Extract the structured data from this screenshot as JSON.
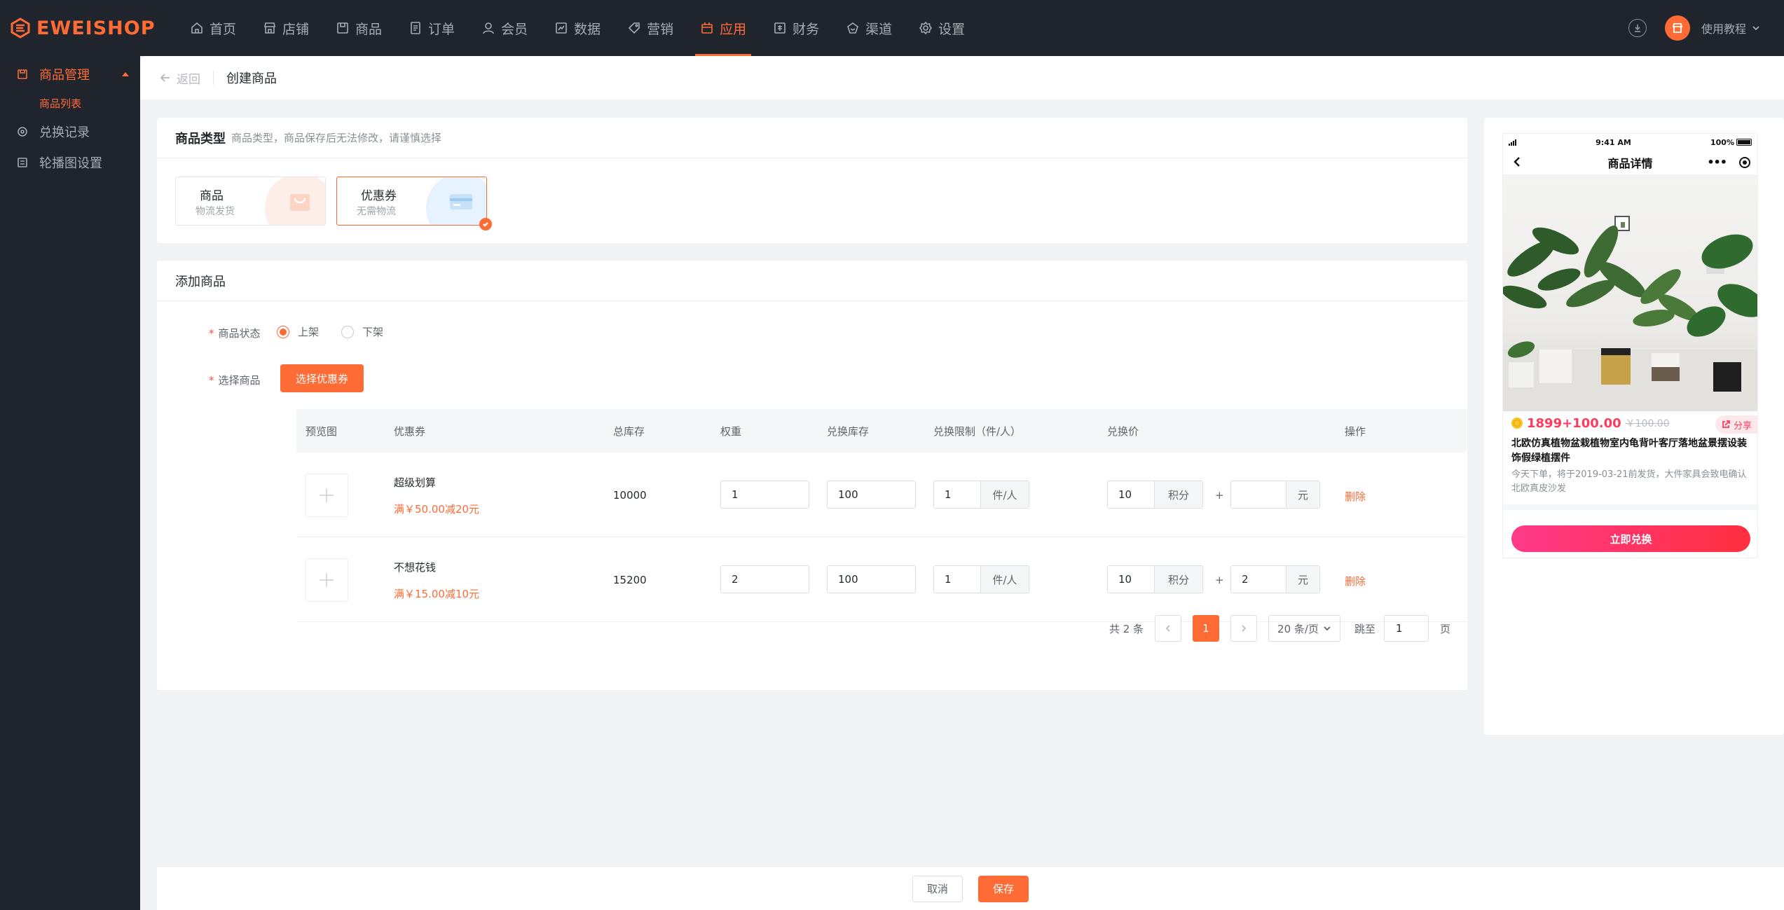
{
  "brand": {
    "name": "EWEISHOP",
    "accent": "#ff6b35"
  },
  "topnav": [
    {
      "label": "首页",
      "icon": "home-icon"
    },
    {
      "label": "店铺",
      "icon": "store-icon"
    },
    {
      "label": "商品",
      "icon": "goods-icon"
    },
    {
      "label": "订单",
      "icon": "order-icon"
    },
    {
      "label": "会员",
      "icon": "member-icon"
    },
    {
      "label": "数据",
      "icon": "chart-icon"
    },
    {
      "label": "营销",
      "icon": "tag-icon"
    },
    {
      "label": "应用",
      "icon": "app-icon",
      "active": true
    },
    {
      "label": "财务",
      "icon": "finance-icon"
    },
    {
      "label": "渠道",
      "icon": "channel-icon"
    },
    {
      "label": "设置",
      "icon": "gear-icon"
    }
  ],
  "topright": {
    "tutorial": "使用教程"
  },
  "sidebar": {
    "group": "商品管理",
    "sub": "商品列表",
    "items": [
      "兑换记录",
      "轮播图设置"
    ]
  },
  "breadcrumb": {
    "back": "返回",
    "title": "创建商品"
  },
  "type_card": {
    "title": "商品类型",
    "hint": "商品类型，商品保存后无法修改，请谨慎选择",
    "options": [
      {
        "name": "商品",
        "desc": "物流发货",
        "selected": false
      },
      {
        "name": "优惠券",
        "desc": "无需物流",
        "selected": true
      }
    ]
  },
  "add_card": {
    "title": "添加商品",
    "status_label": "商品状态",
    "status_options": [
      "上架",
      "下架"
    ],
    "status_selected": "上架",
    "select_label": "选择商品",
    "select_button": "选择优惠券"
  },
  "table": {
    "headers": [
      "预览图",
      "优惠券",
      "总库存",
      "权重",
      "兑换库存",
      "兑换限制（件/人）",
      "兑换价",
      "操作"
    ],
    "rows": [
      {
        "name": "超级划算",
        "rule": "满￥50.00减20元",
        "stock": "10000",
        "weight": "1",
        "ex_stock": "100",
        "limit": "1",
        "limit_unit": "件/人",
        "points": "10",
        "points_unit": "积分",
        "plus": "+",
        "cash": "",
        "cash_unit": "元",
        "action": "删除"
      },
      {
        "name": "不想花钱",
        "rule": "满￥15.00减10元",
        "stock": "15200",
        "weight": "2",
        "ex_stock": "100",
        "limit": "1",
        "limit_unit": "件/人",
        "points": "10",
        "points_unit": "积分",
        "plus": "+",
        "cash": "2",
        "cash_unit": "元",
        "action": "删除"
      }
    ]
  },
  "pager": {
    "total": "共 2 条",
    "current": "1",
    "size": "20 条/页",
    "jump_label": "跳至",
    "jump_value": "1",
    "page_unit": "页"
  },
  "preview": {
    "time": "9:41 AM",
    "battery": "100%",
    "nav_title": "商品详情",
    "price": "1899+100.00",
    "orig_price": "￥100.00",
    "share": "分享",
    "title": "北欧仿真植物盆栽植物室内龟背叶客厅落地盆景摆设装饰假绿植摆件",
    "desc": "今天下单，将于2019-03-21前发货，大件家具会致电确认北欧真皮沙发",
    "button": "立即兑换"
  },
  "footer": {
    "cancel": "取消",
    "save": "保存"
  }
}
